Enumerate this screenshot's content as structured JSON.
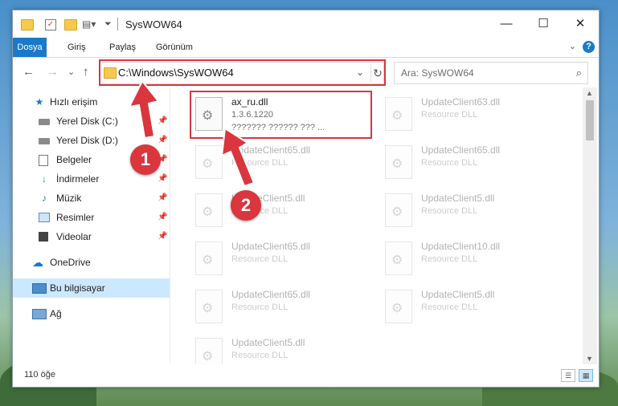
{
  "window": {
    "title": "SysWOW64",
    "controls": {
      "minimize": "—",
      "maximize": "☐",
      "close": "✕"
    }
  },
  "ribbon": {
    "tabs": [
      "Dosya",
      "Giriş",
      "Paylaş",
      "Görünüm"
    ],
    "help": "?"
  },
  "nav": {
    "back": "←",
    "forward": "→",
    "recent": "⌄",
    "up": "↑",
    "address": "C:\\Windows\\SysWOW64",
    "search_placeholder": "Ara: SysWOW64"
  },
  "sidebar": {
    "items": [
      {
        "label": "Hızlı erişim",
        "icon": "star-icon",
        "pinned": false
      },
      {
        "label": "Yerel Disk (C:)",
        "icon": "drive-icon",
        "pinned": true
      },
      {
        "label": "Yerel Disk (D:)",
        "icon": "drive-icon",
        "pinned": true
      },
      {
        "label": "Belgeler",
        "icon": "documents-icon",
        "pinned": true
      },
      {
        "label": "İndirmeler",
        "icon": "download-icon",
        "pinned": true
      },
      {
        "label": "Müzik",
        "icon": "music-icon",
        "pinned": true
      },
      {
        "label": "Resimler",
        "icon": "pictures-icon",
        "pinned": true
      },
      {
        "label": "Videolar",
        "icon": "video-icon",
        "pinned": true
      },
      {
        "label": "OneDrive",
        "icon": "cloud-icon",
        "pinned": false
      },
      {
        "label": "Bu bilgisayar",
        "icon": "computer-icon",
        "pinned": false,
        "selected": true
      },
      {
        "label": "Ağ",
        "icon": "network-icon",
        "pinned": false
      }
    ]
  },
  "files": {
    "highlighted": {
      "name": "ax_ru.dll",
      "version": "1.3.6.1220",
      "description": "??????? ?????? ??? ..."
    },
    "faded": [
      {
        "name": "UpdateClient63.dll",
        "type": "Resource DLL"
      },
      {
        "name": "UpdateClient65.dll",
        "type": "Resource DLL"
      },
      {
        "name": "UpdateClient65.dll",
        "type": "Resource DLL"
      },
      {
        "name": "UpdateClient5.dll",
        "type": "Resource DLL"
      },
      {
        "name": "UpdateClient5.dll",
        "type": "Resource DLL"
      },
      {
        "name": "UpdateClient5.dll",
        "type": "Resource DLL"
      },
      {
        "name": "UpdateClient65.dll",
        "type": "Resource DLL"
      },
      {
        "name": "UpdateClient10.dll",
        "type": "Resource DLL"
      },
      {
        "name": "UpdateClient65.dll",
        "type": "Resource DLL"
      },
      {
        "name": "UpdateClient5.dll",
        "type": "Resource DLL"
      }
    ]
  },
  "status": {
    "item_count": "110 öğe"
  },
  "callouts": {
    "one": "1",
    "two": "2"
  },
  "colors": {
    "accent": "#1979ca",
    "highlight": "#d9363e",
    "selection": "#cce8ff"
  }
}
